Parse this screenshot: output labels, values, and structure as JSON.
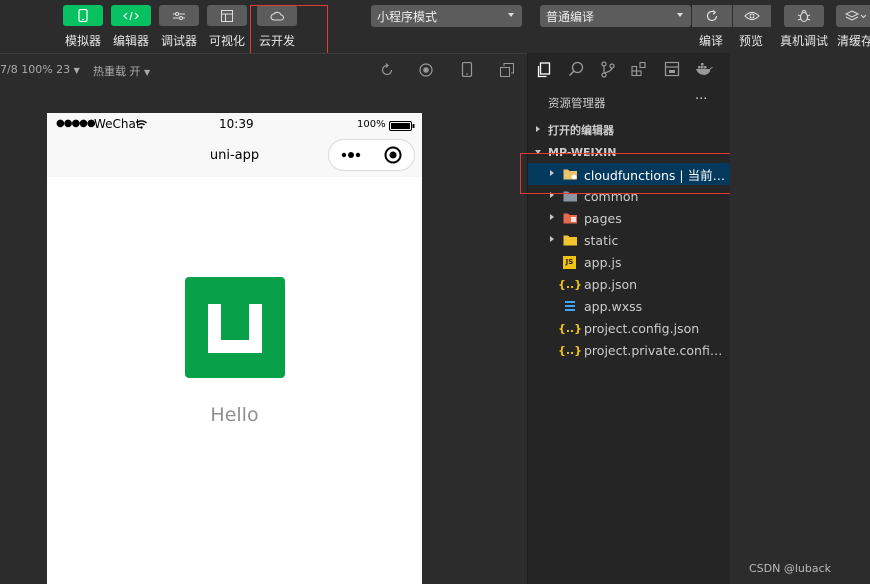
{
  "toolbar": {
    "simulator": "模拟器",
    "editor": "编辑器",
    "debugger": "调试器",
    "visual": "可视化",
    "cloud": "云开发",
    "mode_select": "小程序模式",
    "compile_select": "普通编译",
    "compile": "编译",
    "preview": "预览",
    "real_debug": "真机调试",
    "clear_cache": "清缓存"
  },
  "subbar": {
    "device_info": "7/8 100% 23",
    "hot_reload": "热重载 开"
  },
  "phone": {
    "signal": "●●●●●",
    "carrier": "WeChat",
    "time": "10:39",
    "battery": "100%",
    "nav_title": "uni-app",
    "hello": "Hello"
  },
  "explorer": {
    "title": "资源管理器",
    "more": "···",
    "open_editors": "打开的编辑器",
    "project": "MP-WEIXIN",
    "items": [
      {
        "name": "cloudfunctions | 当前环...",
        "type": "folder-cloud"
      },
      {
        "name": "common",
        "type": "folder"
      },
      {
        "name": "pages",
        "type": "folder-pages"
      },
      {
        "name": "static",
        "type": "folder-static"
      },
      {
        "name": "app.js",
        "type": "js"
      },
      {
        "name": "app.json",
        "type": "json"
      },
      {
        "name": "app.wxss",
        "type": "css"
      },
      {
        "name": "project.config.json",
        "type": "json"
      },
      {
        "name": "project.private.config.js...",
        "type": "json"
      }
    ]
  },
  "watermark": "CSDN @luback",
  "colors": {
    "accent_green": "#07c160",
    "selection": "#04395e",
    "highlight_box": "#e53935",
    "uni_logo": "#09a04a"
  }
}
